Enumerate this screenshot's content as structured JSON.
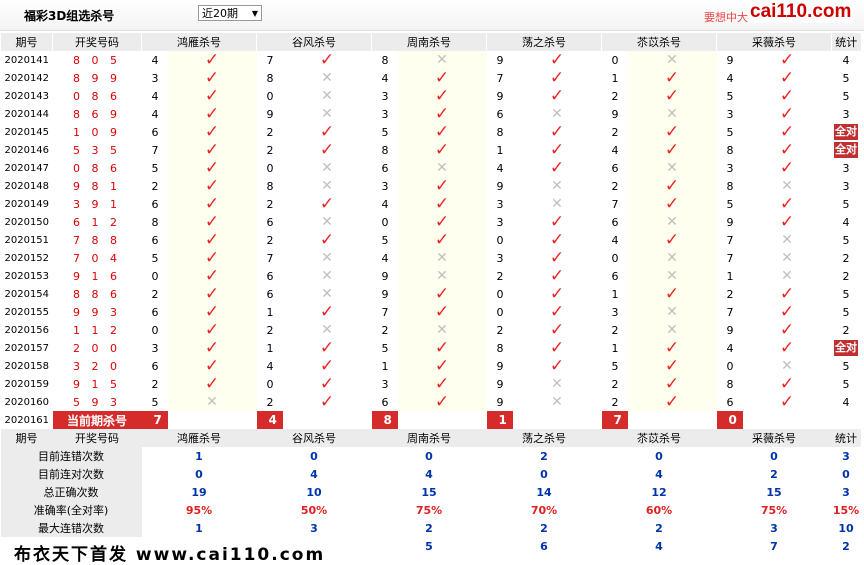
{
  "header": {
    "title": "福彩3D组选杀号",
    "select_value": "近20期",
    "marquee": "要想中大奖",
    "logo": "cai110.com"
  },
  "watermark": "布衣天下首发 www.cai110.com",
  "columns": {
    "period": "期号",
    "draw": "开奖号码",
    "experts": [
      "鸿雁杀号",
      "谷风杀号",
      "周南杀号",
      "荡之杀号",
      "苶苡杀号",
      "采薇杀号"
    ],
    "stat": "统计"
  },
  "rows": [
    {
      "p": "2020141",
      "d": "8 0 5",
      "c": [
        [
          "4",
          "y"
        ],
        [
          "7",
          "y"
        ],
        [
          "8",
          "x"
        ],
        [
          "9",
          "y"
        ],
        [
          "0",
          "x"
        ],
        [
          "9",
          "y"
        ]
      ],
      "s": "4"
    },
    {
      "p": "2020142",
      "d": "8 9 9",
      "c": [
        [
          "3",
          "y"
        ],
        [
          "8",
          "x"
        ],
        [
          "4",
          "y"
        ],
        [
          "7",
          "y"
        ],
        [
          "1",
          "y"
        ],
        [
          "4",
          "y"
        ]
      ],
      "s": "5"
    },
    {
      "p": "2020143",
      "d": "0 8 6",
      "c": [
        [
          "4",
          "y"
        ],
        [
          "0",
          "x"
        ],
        [
          "3",
          "y"
        ],
        [
          "9",
          "y"
        ],
        [
          "2",
          "y"
        ],
        [
          "5",
          "y"
        ]
      ],
      "s": "5"
    },
    {
      "p": "2020144",
      "d": "8 6 9",
      "c": [
        [
          "4",
          "y"
        ],
        [
          "9",
          "x"
        ],
        [
          "3",
          "y"
        ],
        [
          "6",
          "x"
        ],
        [
          "9",
          "x"
        ],
        [
          "3",
          "y"
        ]
      ],
      "s": "3"
    },
    {
      "p": "2020145",
      "d": "1 0 9",
      "c": [
        [
          "6",
          "y"
        ],
        [
          "2",
          "y"
        ],
        [
          "5",
          "y"
        ],
        [
          "8",
          "y"
        ],
        [
          "2",
          "y"
        ],
        [
          "5",
          "y"
        ]
      ],
      "s": "全对"
    },
    {
      "p": "2020146",
      "d": "5 3 5",
      "c": [
        [
          "7",
          "y"
        ],
        [
          "2",
          "y"
        ],
        [
          "8",
          "y"
        ],
        [
          "1",
          "y"
        ],
        [
          "4",
          "y"
        ],
        [
          "8",
          "y"
        ]
      ],
      "s": "全对"
    },
    {
      "p": "2020147",
      "d": "0 8 6",
      "c": [
        [
          "5",
          "y"
        ],
        [
          "0",
          "x"
        ],
        [
          "6",
          "x"
        ],
        [
          "4",
          "y"
        ],
        [
          "6",
          "x"
        ],
        [
          "3",
          "y"
        ]
      ],
      "s": "3"
    },
    {
      "p": "2020148",
      "d": "9 8 1",
      "c": [
        [
          "2",
          "y"
        ],
        [
          "8",
          "x"
        ],
        [
          "3",
          "y"
        ],
        [
          "9",
          "x"
        ],
        [
          "2",
          "y"
        ],
        [
          "8",
          "x"
        ]
      ],
      "s": "3"
    },
    {
      "p": "2020149",
      "d": "3 9 1",
      "c": [
        [
          "6",
          "y"
        ],
        [
          "2",
          "y"
        ],
        [
          "4",
          "y"
        ],
        [
          "3",
          "x"
        ],
        [
          "7",
          "y"
        ],
        [
          "5",
          "y"
        ]
      ],
      "s": "5"
    },
    {
      "p": "2020150",
      "d": "6 1 2",
      "c": [
        [
          "8",
          "y"
        ],
        [
          "6",
          "x"
        ],
        [
          "0",
          "y"
        ],
        [
          "3",
          "y"
        ],
        [
          "6",
          "x"
        ],
        [
          "9",
          "y"
        ]
      ],
      "s": "4"
    },
    {
      "p": "2020151",
      "d": "7 8 8",
      "c": [
        [
          "6",
          "y"
        ],
        [
          "2",
          "y"
        ],
        [
          "5",
          "y"
        ],
        [
          "0",
          "y"
        ],
        [
          "4",
          "y"
        ],
        [
          "7",
          "x"
        ]
      ],
      "s": "5"
    },
    {
      "p": "2020152",
      "d": "7 0 4",
      "c": [
        [
          "5",
          "y"
        ],
        [
          "7",
          "x"
        ],
        [
          "4",
          "x"
        ],
        [
          "3",
          "y"
        ],
        [
          "0",
          "x"
        ],
        [
          "7",
          "x"
        ]
      ],
      "s": "2"
    },
    {
      "p": "2020153",
      "d": "9 1 6",
      "c": [
        [
          "0",
          "y"
        ],
        [
          "6",
          "x"
        ],
        [
          "9",
          "x"
        ],
        [
          "2",
          "y"
        ],
        [
          "6",
          "x"
        ],
        [
          "1",
          "x"
        ]
      ],
      "s": "2"
    },
    {
      "p": "2020154",
      "d": "8 8 6",
      "c": [
        [
          "2",
          "y"
        ],
        [
          "6",
          "x"
        ],
        [
          "9",
          "y"
        ],
        [
          "0",
          "y"
        ],
        [
          "1",
          "y"
        ],
        [
          "2",
          "y"
        ]
      ],
      "s": "5"
    },
    {
      "p": "2020155",
      "d": "9 9 3",
      "c": [
        [
          "6",
          "y"
        ],
        [
          "1",
          "y"
        ],
        [
          "7",
          "y"
        ],
        [
          "0",
          "y"
        ],
        [
          "3",
          "x"
        ],
        [
          "7",
          "y"
        ]
      ],
      "s": "5"
    },
    {
      "p": "2020156",
      "d": "1 1 2",
      "c": [
        [
          "0",
          "y"
        ],
        [
          "2",
          "x"
        ],
        [
          "2",
          "x"
        ],
        [
          "2",
          "y"
        ],
        [
          "2",
          "x"
        ],
        [
          "9",
          "y"
        ]
      ],
      "s": "2"
    },
    {
      "p": "2020157",
      "d": "2 0 0",
      "c": [
        [
          "3",
          "y"
        ],
        [
          "1",
          "y"
        ],
        [
          "5",
          "y"
        ],
        [
          "8",
          "y"
        ],
        [
          "1",
          "y"
        ],
        [
          "4",
          "y"
        ]
      ],
      "s": "全对"
    },
    {
      "p": "2020158",
      "d": "3 2 0",
      "c": [
        [
          "6",
          "y"
        ],
        [
          "4",
          "y"
        ],
        [
          "1",
          "y"
        ],
        [
          "9",
          "y"
        ],
        [
          "5",
          "y"
        ],
        [
          "0",
          "x"
        ]
      ],
      "s": "5"
    },
    {
      "p": "2020159",
      "d": "9 1 5",
      "c": [
        [
          "2",
          "y"
        ],
        [
          "0",
          "y"
        ],
        [
          "3",
          "y"
        ],
        [
          "9",
          "x"
        ],
        [
          "2",
          "y"
        ],
        [
          "8",
          "y"
        ]
      ],
      "s": "5"
    },
    {
      "p": "2020160",
      "d": "5 9 3",
      "c": [
        [
          "5",
          "x"
        ],
        [
          "2",
          "y"
        ],
        [
          "6",
          "y"
        ],
        [
          "9",
          "x"
        ],
        [
          "2",
          "y"
        ],
        [
          "6",
          "y"
        ]
      ],
      "s": "4"
    }
  ],
  "current": {
    "period": "2020161",
    "label": "当前期杀号",
    "values": [
      "7",
      "4",
      "8",
      "1",
      "7",
      "0"
    ]
  },
  "summary": [
    {
      "label": "目前连错次数",
      "values": [
        "1",
        "0",
        "0",
        "2",
        "0",
        "0"
      ],
      "stat": "3",
      "red": false
    },
    {
      "label": "目前连对次数",
      "values": [
        "0",
        "4",
        "4",
        "0",
        "4",
        "2"
      ],
      "stat": "0",
      "red": false
    },
    {
      "label": "总正确次数",
      "values": [
        "19",
        "10",
        "15",
        "14",
        "12",
        "15"
      ],
      "stat": "3",
      "red": false
    },
    {
      "label": "准确率(全对率)",
      "values": [
        "95%",
        "50%",
        "75%",
        "70%",
        "60%",
        "75%"
      ],
      "stat": "15%",
      "red": true
    },
    {
      "label": "最大连错次数",
      "values": [
        "1",
        "3",
        "2",
        "2",
        "2",
        "3"
      ],
      "stat": "10",
      "red": false
    }
  ],
  "extra_row": {
    "values": [
      "",
      "",
      "5",
      "6",
      "4",
      "7"
    ],
    "stat": "2"
  }
}
